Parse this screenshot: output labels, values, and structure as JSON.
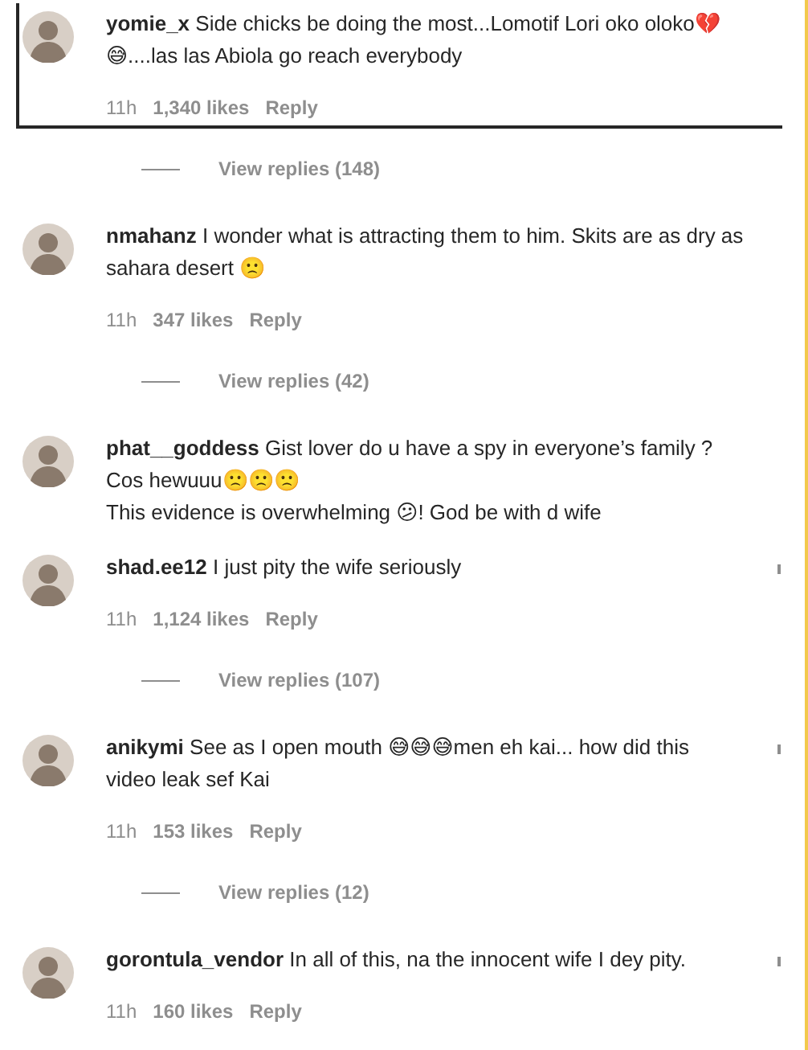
{
  "comments": [
    {
      "username": "yomie_x",
      "text": "Side chicks be doing the most...Lomotif Lori oko oloko💔😅....las las Abiola go reach everybody",
      "time": "11h",
      "likes": "1,340 likes",
      "reply": "Reply",
      "highlighted": true,
      "view_replies": "View replies (148)"
    },
    {
      "username": "nmahanz",
      "text": "I wonder what is attracting them to him. Skits are as dry as sahara desert 🙁",
      "time": "11h",
      "likes": "347 likes",
      "reply": "Reply",
      "highlighted": false,
      "view_replies": "View replies (42)"
    },
    {
      "username": "phat__goddess",
      "text": "Gist lover do u have a spy in everyone’s family ? Cos hewuuu🙁🙁🙁",
      "extra_line": "This evidence is overwhelming 😕! God be with d wife",
      "highlighted": false
    },
    {
      "username": "shad.ee12",
      "text": "I just pity the wife seriously",
      "time": "11h",
      "likes": "1,124 likes",
      "reply": "Reply",
      "highlighted": false,
      "view_replies": "View replies (107)"
    },
    {
      "username": "anikymi",
      "text": "See as I open mouth 😅😅😅men eh kai... how did this video leak sef Kai",
      "time": "11h",
      "likes": "153 likes",
      "reply": "Reply",
      "highlighted": false,
      "view_replies": "View replies (12)"
    },
    {
      "username": "gorontula_vendor",
      "text": "In all of this, na the innocent wife I dey pity.",
      "time": "11h",
      "likes": "160 likes",
      "reply": "Reply",
      "highlighted": false
    }
  ]
}
